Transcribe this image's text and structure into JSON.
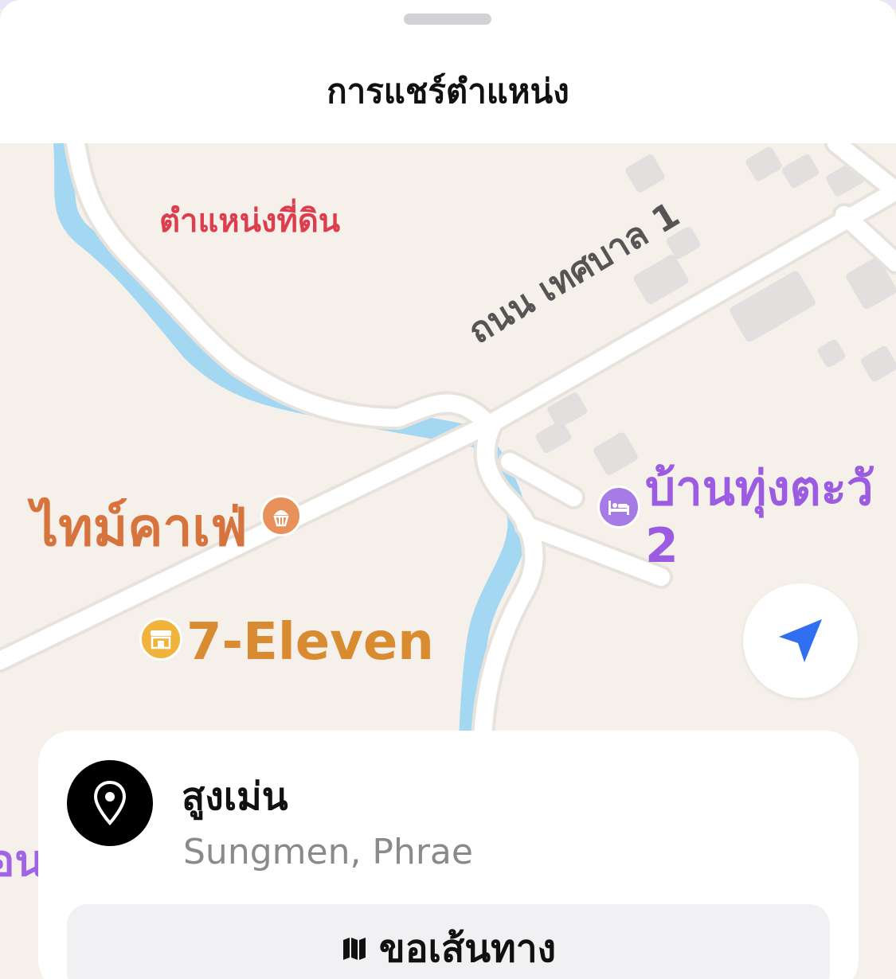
{
  "sheet": {
    "title": "การแชร์ตำแหน่ง"
  },
  "map": {
    "pin_label": "ตำแหน่งที่ดิน",
    "road_label": "ถนน เทศบาล 1",
    "cafe_label": "ไทม์คาเฟ่",
    "seven_label": "7-Eleven",
    "hotel_label_line1": "บ้านทุ่งตะวั",
    "hotel_label_line2": "2",
    "edge_label": "อน",
    "icons": [
      "cafe-icon",
      "store-icon",
      "bed-icon",
      "location-arrow-icon"
    ],
    "colors": {
      "water": "#9fd4f0",
      "road": "#ffffff",
      "land": "#f5f1ea",
      "building": "#e4e2e0",
      "locate": "#2f6ff0"
    }
  },
  "card": {
    "place_name": "สูงเม่น",
    "place_subtitle": "Sungmen, Phrae",
    "directions_label": "ขอเส้นทาง",
    "icons": [
      "location-pin-icon",
      "map-icon"
    ]
  }
}
